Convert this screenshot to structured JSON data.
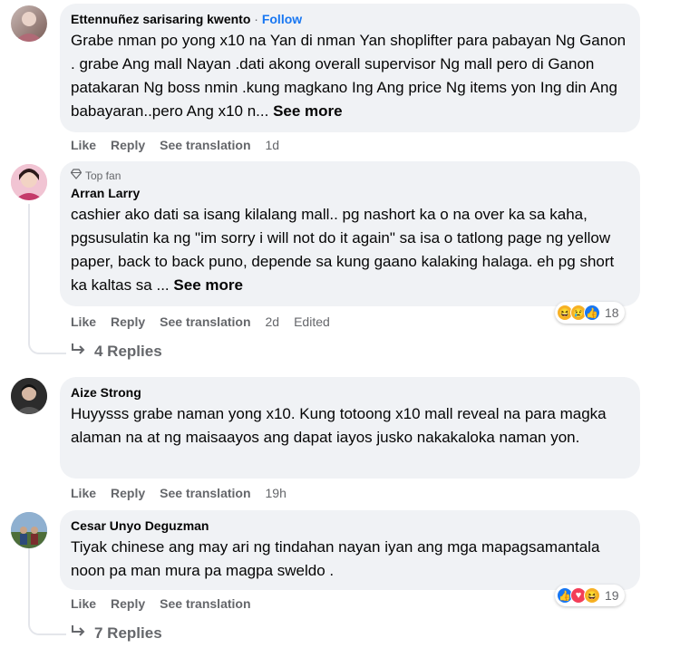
{
  "comments": [
    {
      "author": "Ettennuñez sarisaring kwento",
      "separator": "·",
      "follow": "Follow",
      "text": "Grabe nman po yong x10 na Yan di nman Yan shoplifter para pabayan Ng Ganon . grabe Ang mall Nayan .dati akong overall supervisor Ng mall pero di Ganon patakaran Ng boss nmin .kung magkano Ing Ang price Ng items yon Ing din Ang babayaran..pero Ang x10 n...",
      "see_more": "See more",
      "like": "Like",
      "reply": "Reply",
      "translate": "See translation",
      "time": "1d"
    },
    {
      "badge": "Top fan",
      "author": "Arran Larry",
      "text": "cashier ako dati sa isang kilalang mall.. pg nashort ka o na over ka sa kaha, pgsusulatin ka ng \"im sorry i will not do it again\" sa isa o tatlong page ng yellow paper, back to back puno, depende sa kung gaano kalaking halaga. eh pg short ka kaltas sa ...",
      "see_more": "See more",
      "like": "Like",
      "reply": "Reply",
      "translate": "See translation",
      "time": "2d",
      "edited": "Edited",
      "reaction_count": "18",
      "replies": "4 Replies"
    },
    {
      "author": "Aize Strong",
      "text": "Huyysss grabe naman yong x10. Kung totoong x10 mall reveal na para magka alaman na at ng maisaayos ang dapat iayos jusko nakakaloka naman yon.",
      "like": "Like",
      "reply": "Reply",
      "translate": "See translation",
      "time": "19h"
    },
    {
      "author": "Cesar Unyo Deguzman",
      "text": "Tiyak chinese ang may ari ng tindahan nayan iyan ang mga mapagsamantala noon pa man mura pa magpa sweldo .",
      "like": "Like",
      "reply": "Reply",
      "translate": "See translation",
      "reaction_count": "19",
      "replies": "7 Replies"
    }
  ],
  "icons": {
    "reply_arrow": "reply-arrow-icon",
    "top_fan": "diamond-icon",
    "reactions": [
      "haha-icon",
      "sad-icon",
      "like-icon",
      "love-icon"
    ]
  },
  "colors": {
    "follow": "#1877f2",
    "meta": "#65676b",
    "bubble": "#f0f2f5"
  }
}
